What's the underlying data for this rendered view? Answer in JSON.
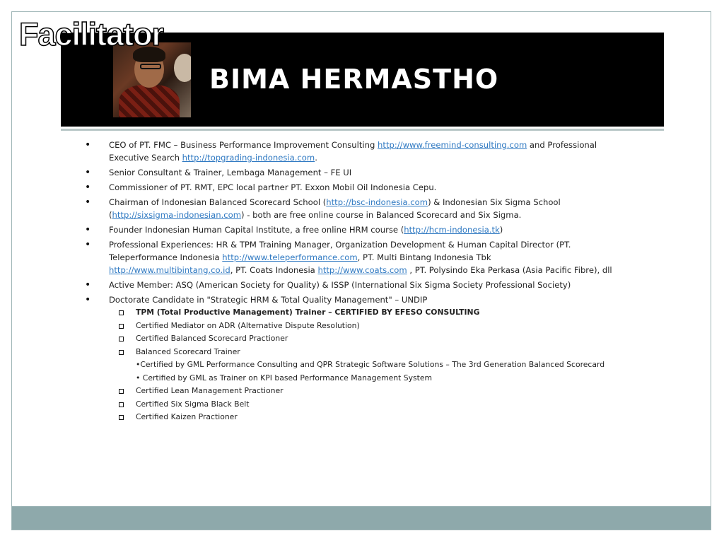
{
  "slide": {
    "title": "Facilitator",
    "banner_name": "BIMA HERMASTHO",
    "photo_icon": "portrait-photo",
    "colors": {
      "banner": "#000000",
      "footer": "#8ea9ab",
      "link": "#2f79c2",
      "frame_border": "#9fb5b6"
    }
  },
  "bullets": [
    {
      "parts": [
        {
          "text": "CEO of PT. FMC –  Business Performance Improvement Consulting  "
        },
        {
          "text": "http://www.freemind-consulting.com",
          "link": true
        },
        {
          "text": "  and Professional Executive Search "
        },
        {
          "text": "http://topgrading-indonesia.com",
          "link": true
        },
        {
          "text": "."
        }
      ]
    },
    {
      "parts": [
        {
          "text": "Senior Consultant  & Trainer, Lembaga Management  – FE UI"
        }
      ]
    },
    {
      "parts": [
        {
          "text": "Commissioner of PT. RMT,  EPC local partner PT. Exxon Mobil Oil  Indonesia  Cepu."
        }
      ]
    },
    {
      "parts": [
        {
          "text": "Chairman of Indonesian  Balanced Scorecard School ("
        },
        {
          "text": "http://bsc-indonesia.com",
          "link": true
        },
        {
          "text": ")  & Indonesian Six Sigma School ("
        },
        {
          "text": "http://sixsigma-indonesian.com",
          "link": true
        },
        {
          "text": ")  - both are free online  course in Balanced Scorecard and Six Sigma."
        }
      ]
    },
    {
      "parts": [
        {
          "text": "Founder  Indonesian  Human Capital Institute, a free online  HRM course ("
        },
        {
          "text": "http://hcm-indonesia.tk",
          "link": true
        },
        {
          "text": ")"
        }
      ]
    },
    {
      "parts": [
        {
          "text": "Professional  Experiences: HR & TPM Training Manager, Organization Development  & Human Capital Director (PT. Teleperformance  Indonesia  "
        },
        {
          "text": "http://www.teleperformance.com",
          "link": true
        },
        {
          "text": ",  PT. Multi Bintang Indonesia  Tbk "
        },
        {
          "text": "http://www.multibintang.co.id",
          "link": true
        },
        {
          "text": ",  PT. Coats Indonesia  "
        },
        {
          "text": "http://www.coats.com",
          "link": true
        },
        {
          "text": "  , PT. Polysindo  Eka Perkasa (Asia Pacific Fibre), dll"
        }
      ]
    },
    {
      "parts": [
        {
          "text": "Active Member: ASQ (American Society for Quality) & ISSP (International  Six Sigma Society Professional  Society)"
        }
      ]
    },
    {
      "parts": [
        {
          "text": "Doctorate Candidate  in \"Strategic HRM & Total Quality  Management\"  – UNDIP"
        }
      ]
    }
  ],
  "certifications": [
    {
      "text": "TPM (Total Productive Management) Trainer – CERTIFIED BY EFESO  CONSULTING",
      "bold": true,
      "square": true
    },
    {
      "text": "Certified Mediator on ADR (Alternative Dispute Resolution)",
      "square": true
    },
    {
      "text": "Certified Balanced Scorecard Practioner",
      "square": true
    },
    {
      "text": "Balanced Scorecard Trainer",
      "square": true
    },
    {
      "text": "•Certified by GML  Performance Consulting and QPR Strategic Software Solutions – The 3rd Generation Balanced Scorecard",
      "square": false
    },
    {
      "text": "• Certified by GML as Trainer on KPI based Performance Management System",
      "square": false
    },
    {
      "text": "Certified Lean Management  Practioner",
      "square": true
    },
    {
      "text": "Certified Six Sigma Black Belt",
      "square": true
    },
    {
      "text": "Certified Kaizen Practioner",
      "square": true
    }
  ]
}
